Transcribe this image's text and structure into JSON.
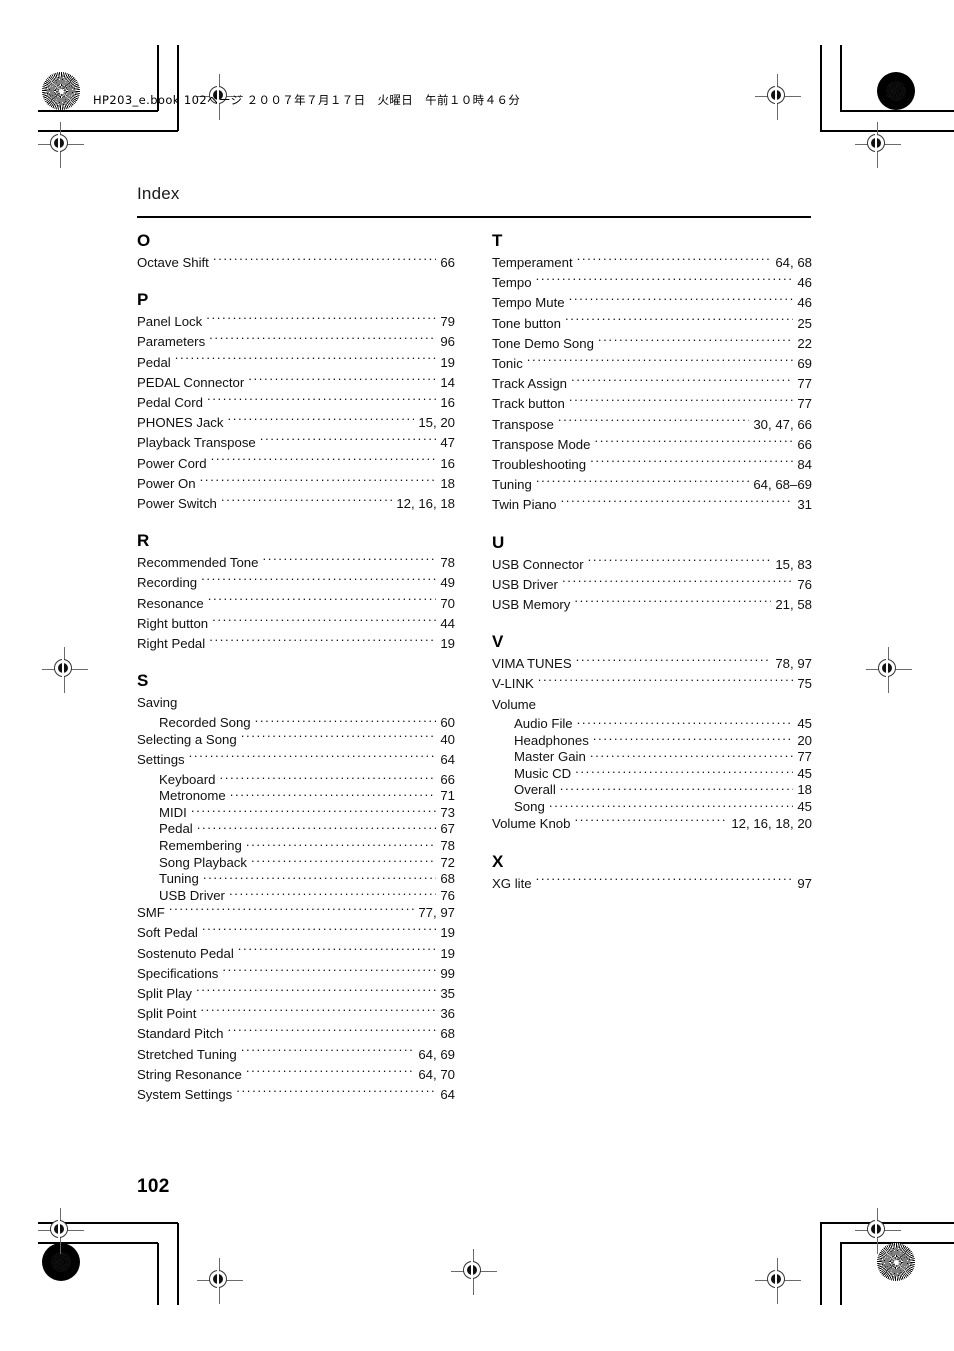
{
  "book_header": "HP203_e.book  102ページ  ２００７年７月１７日　火曜日　午前１０時４６分",
  "page_title": "Index",
  "page_number": "102",
  "columns": {
    "left": [
      {
        "letter": "O",
        "entries": [
          {
            "term": "Octave Shift",
            "pages": "66",
            "sub": false
          }
        ]
      },
      {
        "letter": "P",
        "entries": [
          {
            "term": "Panel Lock",
            "pages": "79",
            "sub": false
          },
          {
            "term": "Parameters",
            "pages": "96",
            "sub": false
          },
          {
            "term": "Pedal",
            "pages": "19",
            "sub": false
          },
          {
            "term": "PEDAL Connector",
            "pages": "14",
            "sub": false
          },
          {
            "term": "Pedal Cord",
            "pages": "16",
            "sub": false
          },
          {
            "term": "PHONES Jack",
            "pages": "15, 20",
            "sub": false
          },
          {
            "term": "Playback Transpose",
            "pages": "47",
            "sub": false
          },
          {
            "term": "Power Cord",
            "pages": "16",
            "sub": false
          },
          {
            "term": "Power On",
            "pages": "18",
            "sub": false
          },
          {
            "term": "Power Switch",
            "pages": "12, 16, 18",
            "sub": false
          }
        ]
      },
      {
        "letter": "R",
        "entries": [
          {
            "term": "Recommended Tone",
            "pages": "78",
            "sub": false
          },
          {
            "term": "Recording",
            "pages": "49",
            "sub": false
          },
          {
            "term": "Resonance",
            "pages": "70",
            "sub": false
          },
          {
            "term": "Right button",
            "pages": "44",
            "sub": false
          },
          {
            "term": "Right Pedal",
            "pages": "19",
            "sub": false
          }
        ]
      },
      {
        "letter": "S",
        "entries": [
          {
            "term": "Saving",
            "pages": "",
            "sub": false,
            "noleader": true
          },
          {
            "term": "Recorded Song",
            "pages": "60",
            "sub": true
          },
          {
            "term": "Selecting a Song",
            "pages": "40",
            "sub": false
          },
          {
            "term": "Settings",
            "pages": "64",
            "sub": false
          },
          {
            "term": "Keyboard",
            "pages": "66",
            "sub": true
          },
          {
            "term": "Metronome",
            "pages": "71",
            "sub": true
          },
          {
            "term": "MIDI",
            "pages": "73",
            "sub": true
          },
          {
            "term": "Pedal",
            "pages": "67",
            "sub": true
          },
          {
            "term": "Remembering",
            "pages": "78",
            "sub": true
          },
          {
            "term": "Song Playback",
            "pages": "72",
            "sub": true
          },
          {
            "term": "Tuning",
            "pages": "68",
            "sub": true
          },
          {
            "term": "USB Driver",
            "pages": "76",
            "sub": true
          },
          {
            "term": "SMF",
            "pages": "77, 97",
            "sub": false
          },
          {
            "term": "Soft Pedal",
            "pages": "19",
            "sub": false
          },
          {
            "term": "Sostenuto Pedal",
            "pages": "19",
            "sub": false
          },
          {
            "term": "Specifications",
            "pages": "99",
            "sub": false
          },
          {
            "term": "Split Play",
            "pages": "35",
            "sub": false
          },
          {
            "term": "Split Point",
            "pages": "36",
            "sub": false
          },
          {
            "term": "Standard Pitch",
            "pages": "68",
            "sub": false
          },
          {
            "term": "Stretched Tuning",
            "pages": "64, 69",
            "sub": false
          },
          {
            "term": "String Resonance",
            "pages": "64, 70",
            "sub": false
          },
          {
            "term": "System Settings",
            "pages": "64",
            "sub": false
          }
        ]
      }
    ],
    "right": [
      {
        "letter": "T",
        "entries": [
          {
            "term": "Temperament",
            "pages": "64, 68",
            "sub": false
          },
          {
            "term": "Tempo",
            "pages": "46",
            "sub": false
          },
          {
            "term": "Tempo Mute",
            "pages": "46",
            "sub": false
          },
          {
            "term": "Tone button",
            "pages": "25",
            "sub": false
          },
          {
            "term": "Tone Demo Song",
            "pages": "22",
            "sub": false
          },
          {
            "term": "Tonic",
            "pages": "69",
            "sub": false
          },
          {
            "term": "Track Assign",
            "pages": "77",
            "sub": false
          },
          {
            "term": "Track button",
            "pages": "77",
            "sub": false
          },
          {
            "term": "Transpose",
            "pages": "30, 47, 66",
            "sub": false
          },
          {
            "term": "Transpose Mode",
            "pages": "66",
            "sub": false
          },
          {
            "term": "Troubleshooting",
            "pages": "84",
            "sub": false
          },
          {
            "term": "Tuning",
            "pages": "64, 68–69",
            "sub": false
          },
          {
            "term": "Twin Piano",
            "pages": "31",
            "sub": false
          }
        ]
      },
      {
        "letter": "U",
        "entries": [
          {
            "term": "USB Connector",
            "pages": "15, 83",
            "sub": false
          },
          {
            "term": "USB Driver",
            "pages": "76",
            "sub": false
          },
          {
            "term": "USB Memory",
            "pages": "21, 58",
            "sub": false
          }
        ]
      },
      {
        "letter": "V",
        "entries": [
          {
            "term": "VIMA TUNES",
            "pages": "78, 97",
            "sub": false
          },
          {
            "term": "V-LINK",
            "pages": "75",
            "sub": false
          },
          {
            "term": "Volume",
            "pages": "",
            "sub": false,
            "noleader": true
          },
          {
            "term": "Audio File",
            "pages": "45",
            "sub": true
          },
          {
            "term": "Headphones",
            "pages": "20",
            "sub": true
          },
          {
            "term": "Master Gain",
            "pages": "77",
            "sub": true
          },
          {
            "term": "Music CD",
            "pages": "45",
            "sub": true
          },
          {
            "term": "Overall",
            "pages": "18",
            "sub": true
          },
          {
            "term": "Song",
            "pages": "45",
            "sub": true
          },
          {
            "term": "Volume Knob",
            "pages": "12, 16, 18, 20",
            "sub": false
          }
        ]
      },
      {
        "letter": "X",
        "entries": [
          {
            "term": "XG lite",
            "pages": "97",
            "sub": false
          }
        ]
      }
    ]
  },
  "print_marks": {
    "rosette_top_left": "halftone-rosette-light",
    "rosette_top_right": "halftone-rosette-dark",
    "rosette_bottom_left": "halftone-rosette-dark",
    "rosette_bottom_right": "halftone-rosette-light",
    "registration_marks": "registration-crosshair"
  }
}
